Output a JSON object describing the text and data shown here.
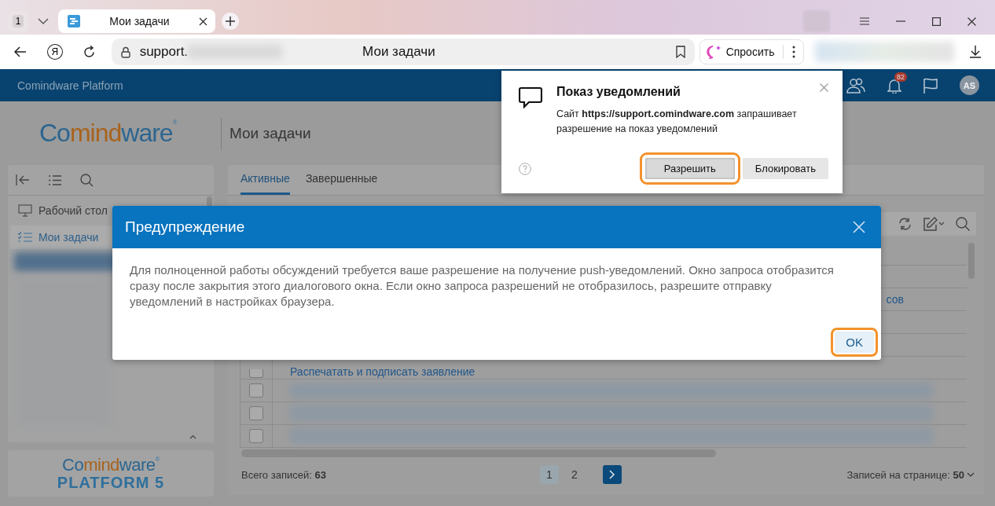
{
  "browser": {
    "tab_count": "1",
    "tabs": [
      {
        "title": "Мои задачи",
        "selected": true
      }
    ],
    "yandex_button": "Я",
    "address": {
      "host": "support.",
      "page_title": "Мои задачи"
    },
    "ask_button": "Спросить"
  },
  "app_header": {
    "title": "Comindware Platform",
    "notification_count": "82",
    "avatar_initials": "AS"
  },
  "logo": {
    "segments": [
      {
        "text": "Co",
        "color": "#2c6590"
      },
      {
        "text": "mind",
        "color": "#a8631c"
      },
      {
        "text": "ware",
        "color": "#2c6590"
      }
    ],
    "mark": "®"
  },
  "page_title": "Мои задачи",
  "sidebar": {
    "items": [
      {
        "label": "Рабочий стол",
        "kind": "desktop",
        "selected": false
      },
      {
        "label": "Мои задачи",
        "kind": "tasks",
        "selected": true
      }
    ]
  },
  "sidebar_logo": {
    "segments": [
      {
        "text": "Co",
        "color": "#2c6590"
      },
      {
        "text": "mind",
        "color": "#a8631c"
      },
      {
        "text": "ware",
        "color": "#2c6590"
      }
    ],
    "mark": "®",
    "product": "PLATFORM 5"
  },
  "tabs": [
    {
      "label": "Активные",
      "selected": true
    },
    {
      "label": "Завершенные",
      "selected": false
    }
  ],
  "table": {
    "rows": [
      {
        "kind": "covered"
      },
      {
        "kind": "covered"
      },
      {
        "kind": "tail",
        "text": "сов"
      },
      {
        "kind": "covered"
      },
      {
        "kind": "covered"
      },
      {
        "kind": "link",
        "text": "Распечатать и подписать заявление",
        "checked": false
      },
      {
        "kind": "blurred",
        "checked": false
      },
      {
        "kind": "blurred",
        "checked": false
      },
      {
        "kind": "blurred",
        "checked": false
      }
    ]
  },
  "footer": {
    "total": "Всего записей: **63**",
    "pages": [
      {
        "label": "1",
        "selected": true
      },
      {
        "label": "2",
        "selected": false
      }
    ],
    "page_size": "Записей на странице: **50**"
  },
  "notification_prompt": {
    "title": "Показ уведомлений",
    "message": "Сайт **https://support.comindware.com** запрашивает разрешение на показ уведомлений",
    "buttons": [
      {
        "label": "Разрешить",
        "highlighted": true
      },
      {
        "label": "Блокировать",
        "highlighted": false
      }
    ]
  },
  "dialog": {
    "title": "Предупреждение",
    "message": "Для полноценной работы обсуждений требуется ваше разрешение на получение push-уведомлений. Окно запроса отобразится сразу после закрытия этого диалогового окна. Если окно запроса разрешений не отобразилось, разрешите отправку уведомлений в настройках браузера.",
    "buttons": [
      {
        "label": "OK",
        "highlighted": true
      }
    ]
  }
}
